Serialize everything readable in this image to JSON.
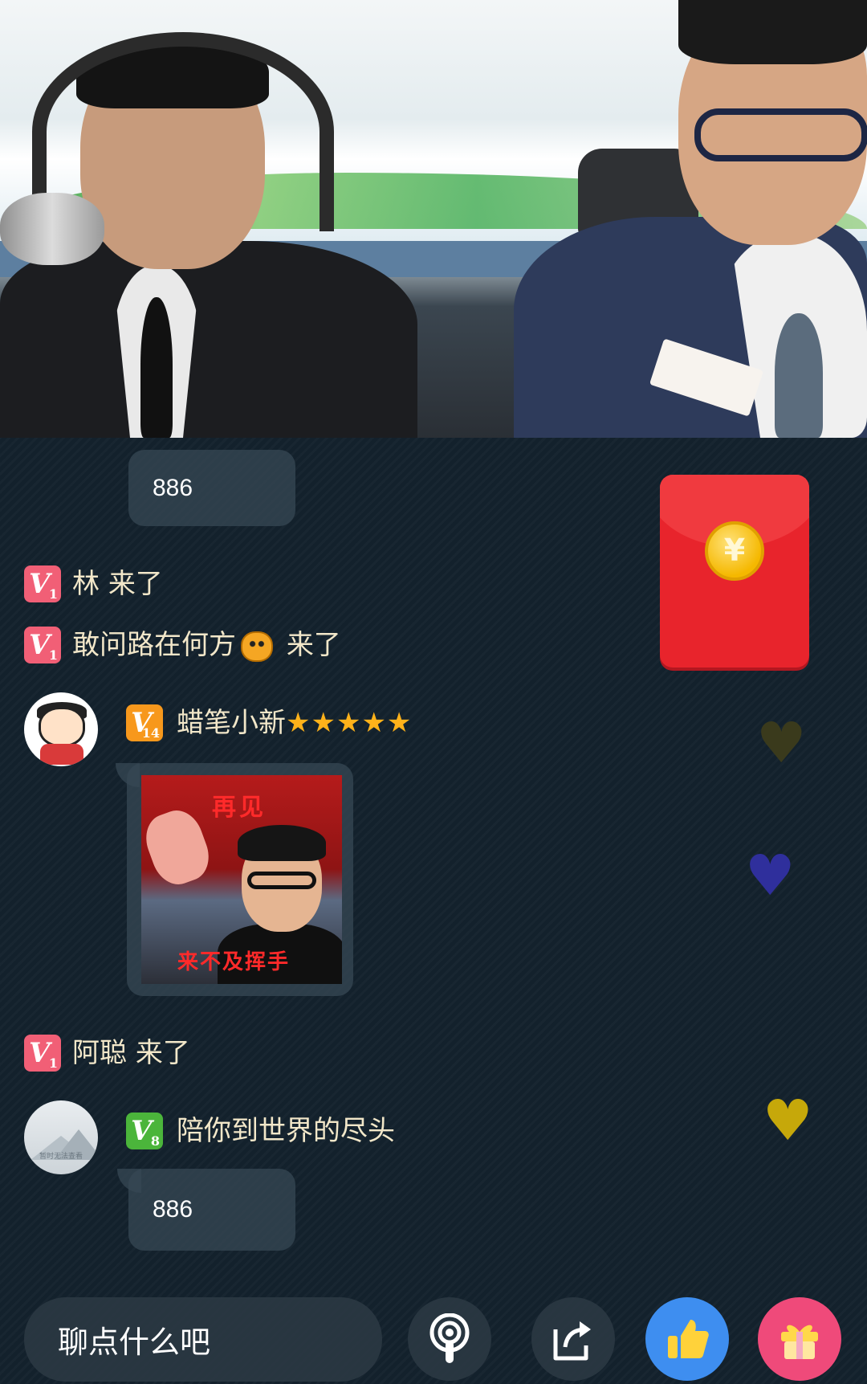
{
  "chat": {
    "bubble_top": "886",
    "join_1": {
      "level": "1",
      "name": "林",
      "suffix": "来了"
    },
    "join_2": {
      "level": "1",
      "name": "敢问路在何方",
      "suffix": "来了"
    },
    "msg_1": {
      "level": "14",
      "username": "蜡笔小新",
      "stars": "★★★★★",
      "sticker_top_text": "再见",
      "sticker_bottom_text": "来不及挥手"
    },
    "join_3": {
      "level": "1",
      "name": "阿聪",
      "suffix": "来了"
    },
    "msg_2": {
      "level": "8",
      "username": "陪你到世界的尽头",
      "avatar_caption": "暂时无法查看",
      "text": "886"
    }
  },
  "red_packet": {
    "symbol": "¥"
  },
  "bottom_bar": {
    "input_placeholder": "聊点什么吧"
  },
  "colors": {
    "level_badge_low": "#f15f76",
    "level_badge_mid": "#f7981c",
    "level_badge_green": "#4bb53b",
    "chat_text": "#f2e7c9",
    "like": "#3e8ef0",
    "gift": "#ef4a7a",
    "red_packet": "#e8242c"
  },
  "icons": [
    "red-packet-icon",
    "podcast-icon",
    "share-icon",
    "thumbs-up-icon",
    "gift-icon",
    "heart-icon"
  ]
}
